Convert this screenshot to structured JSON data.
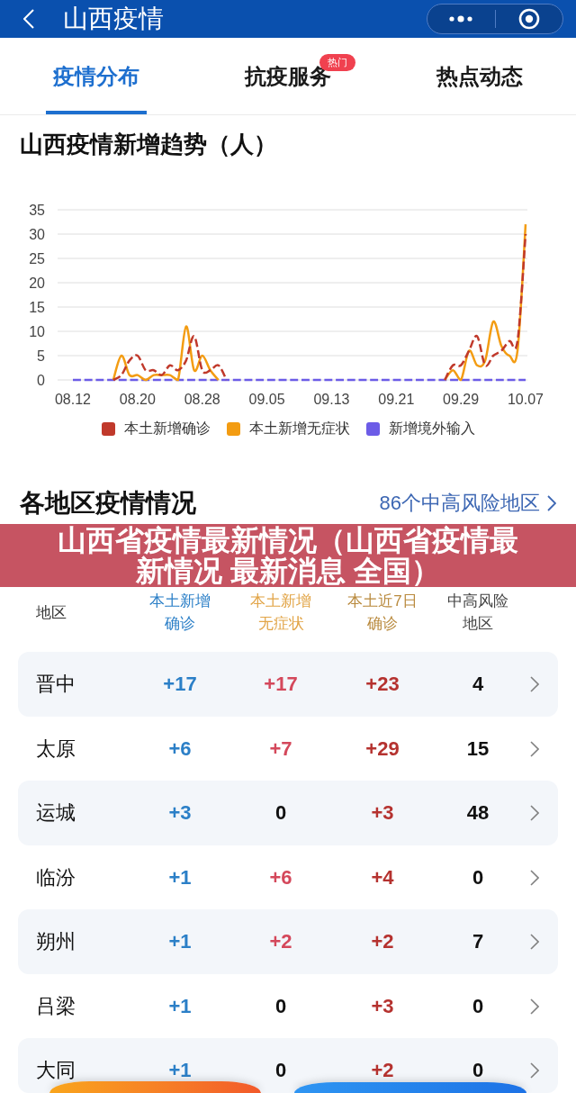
{
  "header": {
    "title": "山西疫情"
  },
  "tabs": [
    {
      "label": "疫情分布",
      "selected": true
    },
    {
      "label": "抗疫服务",
      "selected": false,
      "badge": "热门"
    },
    {
      "label": "热点动态",
      "selected": false
    }
  ],
  "trend": {
    "chart_data": {
      "type": "line",
      "title": "山西疫情新增趋势（人）",
      "grid": true,
      "legend": "bottom",
      "categories": [
        "08.12",
        null,
        null,
        null,
        null,
        null,
        null,
        null,
        "08.20",
        null,
        null,
        null,
        null,
        null,
        null,
        null,
        "08.28",
        null,
        null,
        null,
        null,
        null,
        null,
        null,
        "09.05",
        null,
        null,
        null,
        null,
        null,
        null,
        null,
        "09.13",
        null,
        null,
        null,
        null,
        null,
        null,
        null,
        "09.21",
        null,
        null,
        null,
        null,
        null,
        null,
        null,
        "09.29",
        null,
        null,
        null,
        null,
        null,
        null,
        null,
        "10.07"
      ],
      "ylim": [
        0,
        35
      ],
      "yticks": [
        {
          "value": 0,
          "label": "0"
        },
        {
          "value": 5,
          "label": "5"
        },
        {
          "value": 10,
          "label": "10"
        },
        {
          "value": 15,
          "label": "15"
        },
        {
          "value": 20,
          "label": "20"
        },
        {
          "value": 25,
          "label": "25"
        },
        {
          "value": 30,
          "label": "30"
        },
        {
          "value": 35,
          "label": "35"
        }
      ],
      "series": [
        {
          "name": "本土新增确诊",
          "color": "#c0392b",
          "line_style": "dashed",
          "values": [
            null,
            null,
            null,
            null,
            null,
            0,
            1,
            4,
            5,
            2,
            2,
            1,
            3,
            2,
            4,
            9,
            2,
            2,
            3,
            0,
            null,
            null,
            null,
            null,
            null,
            null,
            null,
            null,
            null,
            null,
            null,
            null,
            null,
            null,
            null,
            null,
            null,
            null,
            null,
            null,
            null,
            null,
            null,
            null,
            null,
            null,
            0,
            3,
            3,
            6,
            9,
            3,
            5,
            6,
            8,
            8,
            30
          ]
        },
        {
          "name": "本土新增无症状",
          "color": "#f39c12",
          "line_style": "solid",
          "values": [
            null,
            null,
            null,
            null,
            null,
            0,
            5,
            1,
            1,
            0,
            1,
            1,
            1,
            0,
            11,
            2,
            5,
            2,
            0,
            null,
            null,
            null,
            null,
            null,
            null,
            null,
            null,
            null,
            null,
            null,
            null,
            null,
            null,
            null,
            null,
            null,
            null,
            null,
            null,
            null,
            null,
            null,
            null,
            null,
            null,
            null,
            0,
            2,
            0,
            6,
            3,
            4,
            12,
            7,
            5,
            6,
            32
          ]
        },
        {
          "name": "新增境外输入",
          "color": "#6c5ce7",
          "line_style": "dashed",
          "values": [
            0,
            0,
            0,
            0,
            0,
            0,
            0,
            0,
            0,
            0,
            0,
            0,
            0,
            0,
            0,
            0,
            0,
            0,
            0,
            0,
            0,
            0,
            0,
            0,
            0,
            0,
            0,
            0,
            0,
            0,
            0,
            0,
            0,
            0,
            0,
            0,
            0,
            0,
            0,
            0,
            0,
            0,
            0,
            0,
            0,
            0,
            0,
            0,
            0,
            0,
            0,
            0,
            0,
            0,
            0,
            0,
            0
          ]
        }
      ]
    }
  },
  "regions": {
    "title": "各地区疫情情况",
    "link": "86个中高风险地区"
  },
  "banner": {
    "text": "山西省疫情最新情况（山西省疫情最新情况 最新消息 全国）"
  },
  "table": {
    "columns": [
      {
        "kind": "region",
        "lines": [
          "地区"
        ]
      },
      {
        "kind": "confirmed",
        "lines": [
          "本土新增",
          "确诊"
        ]
      },
      {
        "kind": "asymptomatic",
        "lines": [
          "本土新增",
          "无症状"
        ]
      },
      {
        "kind": "week",
        "lines": [
          "本土近7日",
          "确诊"
        ]
      },
      {
        "kind": "risk",
        "lines": [
          "中高风险",
          "地区"
        ]
      }
    ],
    "rows": [
      {
        "cells": [
          {
            "text": "晋中",
            "kind": "name"
          },
          {
            "text": "+17",
            "kind": "increase"
          },
          {
            "text": "+17",
            "kind": "increase"
          },
          {
            "text": "+23",
            "kind": "increase"
          },
          {
            "text": "4",
            "kind": "plain"
          }
        ]
      },
      {
        "cells": [
          {
            "text": "太原",
            "kind": "name"
          },
          {
            "text": "+6",
            "kind": "increase"
          },
          {
            "text": "+7",
            "kind": "increase"
          },
          {
            "text": "+29",
            "kind": "increase"
          },
          {
            "text": "15",
            "kind": "plain"
          }
        ]
      },
      {
        "cells": [
          {
            "text": "运城",
            "kind": "name"
          },
          {
            "text": "+3",
            "kind": "increase"
          },
          {
            "text": "0",
            "kind": "plain"
          },
          {
            "text": "+3",
            "kind": "increase"
          },
          {
            "text": "48",
            "kind": "plain"
          }
        ]
      },
      {
        "cells": [
          {
            "text": "临汾",
            "kind": "name"
          },
          {
            "text": "+1",
            "kind": "increase"
          },
          {
            "text": "+6",
            "kind": "increase"
          },
          {
            "text": "+4",
            "kind": "increase"
          },
          {
            "text": "0",
            "kind": "plain"
          }
        ]
      },
      {
        "cells": [
          {
            "text": "朔州",
            "kind": "name"
          },
          {
            "text": "+1",
            "kind": "increase"
          },
          {
            "text": "+2",
            "kind": "increase"
          },
          {
            "text": "+2",
            "kind": "increase"
          },
          {
            "text": "7",
            "kind": "plain"
          }
        ]
      },
      {
        "cells": [
          {
            "text": "吕梁",
            "kind": "name"
          },
          {
            "text": "+1",
            "kind": "increase"
          },
          {
            "text": "0",
            "kind": "plain"
          },
          {
            "text": "+3",
            "kind": "increase"
          },
          {
            "text": "0",
            "kind": "plain"
          }
        ]
      },
      {
        "cells": [
          {
            "text": "大同",
            "kind": "name"
          },
          {
            "text": "+1",
            "kind": "increase"
          },
          {
            "text": "0",
            "kind": "plain"
          },
          {
            "text": "+2",
            "kind": "increase"
          },
          {
            "text": "0",
            "kind": "plain"
          }
        ]
      }
    ]
  }
}
